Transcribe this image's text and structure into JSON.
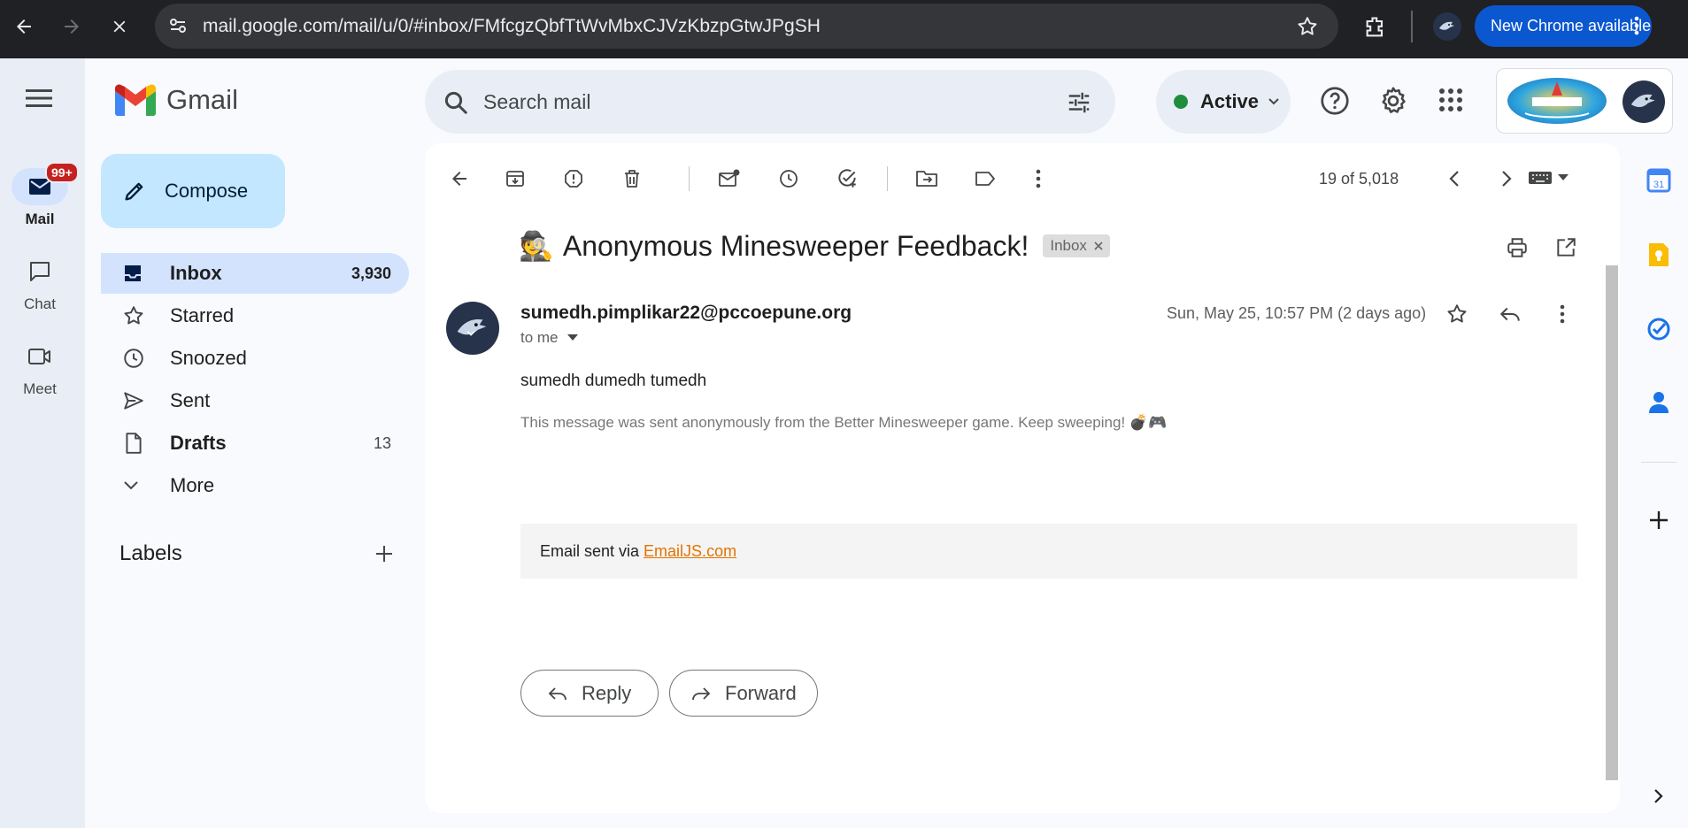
{
  "browser": {
    "url": "mail.google.com/mail/u/0/#inbox/FMfcgzQbfTtWvMbxCJVzKbzpGtwJPgSH",
    "new_chrome_label": "New Chrome available"
  },
  "rail": {
    "mail_label": "Mail",
    "mail_badge": "99+",
    "chat_label": "Chat",
    "meet_label": "Meet"
  },
  "header": {
    "brand": "Gmail",
    "search_placeholder": "Search mail",
    "status_label": "Active"
  },
  "sidebar": {
    "compose_label": "Compose",
    "items": [
      {
        "label": "Inbox",
        "count": "3,930"
      },
      {
        "label": "Starred",
        "count": ""
      },
      {
        "label": "Snoozed",
        "count": ""
      },
      {
        "label": "Sent",
        "count": ""
      },
      {
        "label": "Drafts",
        "count": "13"
      },
      {
        "label": "More",
        "count": ""
      }
    ],
    "labels_heading": "Labels"
  },
  "toolbar": {
    "pagination": "19 of 5,018"
  },
  "message": {
    "subject_emoji": "🕵️",
    "subject": "Anonymous Minesweeper Feedback!",
    "tag": "Inbox",
    "sender": "sumedh.pimplikar22@pccoepune.org",
    "recipient": "to me",
    "date": "Sun, May 25, 10:57 PM (2 days ago)",
    "body_line": "sumedh dumedh tumedh",
    "note": "This message was sent anonymously from the Better Minesweeper game. Keep sweeping! 💣🎮",
    "footer_prefix": "Email sent via ",
    "footer_link": "EmailJS.com",
    "reply_label": "Reply",
    "forward_label": "Forward"
  },
  "colors": {
    "accent": "#0b57d0",
    "compose_bg": "#c2e7ff",
    "selected_bg": "#d3e3fd",
    "link": "#e37400",
    "active_dot": "#1e8e3e"
  }
}
